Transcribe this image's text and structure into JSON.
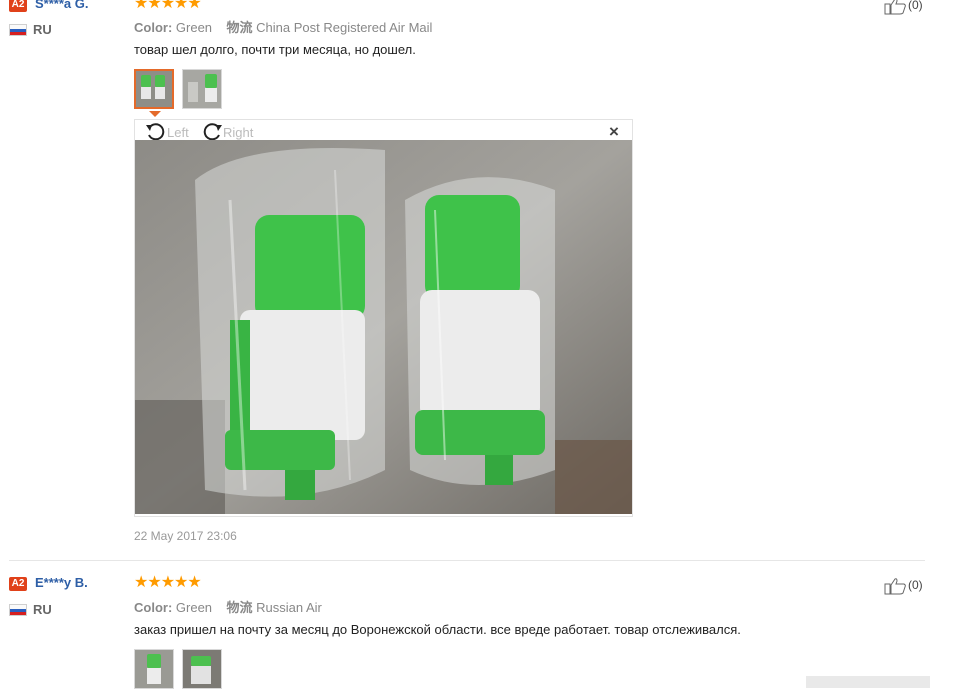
{
  "reviews": [
    {
      "badge": "A2",
      "name": "S****a G.",
      "country": "RU",
      "stars": "★★★★★",
      "color_label": "Color:",
      "color_value": "Green",
      "shipping_label": "物流",
      "shipping_value": "China Post Registered Air Mail",
      "text": "товар шел долго, почти три месяца, но дошел.",
      "date": "22 May 2017 23:06",
      "likes": "(0)"
    },
    {
      "badge": "A2",
      "name": "E****y B.",
      "country": "RU",
      "stars": "★★★★★",
      "color_label": "Color:",
      "color_value": "Green",
      "shipping_label": "物流",
      "shipping_value": "Russian Air",
      "text": "заказ пришел на почту за месяц до Воронежской области. все вреде работает. товар отслеживался.",
      "likes": "(0)"
    }
  ],
  "viewer": {
    "rotate_left": "Left",
    "rotate_right": "Right",
    "close": "×"
  },
  "colors": {
    "star": "#ff9b00",
    "name_link": "#2d5ea6",
    "badge": "#e0411a",
    "product_green": "#3fc24a"
  },
  "icons": [
    "thumbs-up-icon",
    "rotate-left-icon",
    "rotate-right-icon",
    "close-icon",
    "flag-icon"
  ]
}
